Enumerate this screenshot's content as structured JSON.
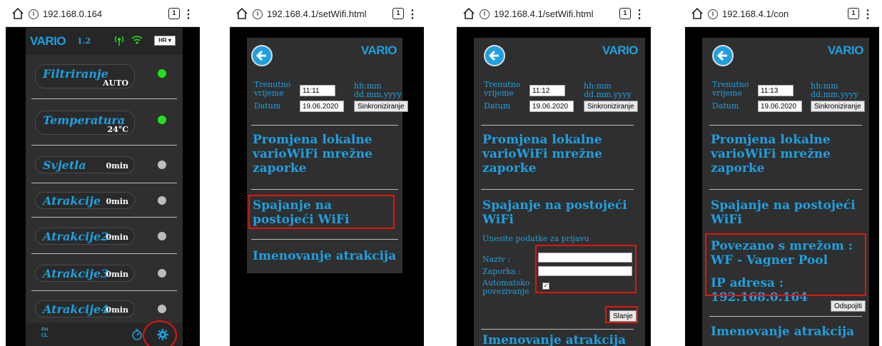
{
  "screens": [
    {
      "url": "192.168.0.164",
      "tab_count": "1",
      "header": {
        "logo": "VARIO",
        "version": "1.2",
        "lang": "HR ▾"
      },
      "items": [
        {
          "name": "Filtriranje",
          "sub": "AUTO",
          "dot": "#22e01e"
        },
        {
          "name": "Temperatura",
          "sub": "24°C",
          "dot": "#22e01e"
        },
        {
          "name": "Svjetla",
          "sub": "0min",
          "dot": "#bdbdbd"
        },
        {
          "name": "Atrakcije",
          "sub": "0min",
          "dot": "#bdbdbd"
        },
        {
          "name": "Atrakcije2",
          "sub": "0min",
          "dot": "#bdbdbd"
        },
        {
          "name": "Atrakcije3",
          "sub": "0min",
          "dot": "#bdbdbd"
        },
        {
          "name": "Atrakcije4",
          "sub": "0min",
          "dot": "#bdbdbd"
        }
      ],
      "footer": {
        "ph_cl": "PH\nCL"
      }
    },
    {
      "url": "192.168.4.1/setWifi.html",
      "tab_count": "1",
      "logo": "VARIO",
      "time_label": "Trenutno vrijeme",
      "time_value": "11:11",
      "time_hint": "hh:mm",
      "date_label": "Datum",
      "date_value": "19.06.2020",
      "date_hint": "dd.mm.yyyy",
      "sync_button": "Sinkroniziranje",
      "section1": "Promjena lokalne varioWiFi mrežne zaporke",
      "section2": "Spajanje na postojeći WiFi",
      "section3": "Imenovanje atrakcija"
    },
    {
      "url": "192.168.4.1/setWifi.html",
      "tab_count": "1",
      "logo": "VARIO",
      "time_label": "Trenutno vrijeme",
      "time_value": "11:12",
      "time_hint": "hh:mm",
      "date_label": "Datum",
      "date_value": "19.06.2020",
      "date_hint": "dd.mm.yyyy",
      "sync_button": "Sinkroniziranje",
      "section1": "Promjena lokalne varioWiFi mrežne zaporke",
      "section2": "Spajanje na postojeći WiFi",
      "login_prompt": "Unesite podatke za prijavu",
      "name_label": "Naziv :",
      "password_label": "Zaporka :",
      "auto_label": "Automatsko povezivanje",
      "send_button": "Slanje",
      "section3": "Imenovanje atrakcija"
    },
    {
      "url": "192.168.4.1/con",
      "tab_count": "1",
      "logo": "VARIO",
      "time_label": "Trenutno vrijeme",
      "time_value": "11:13",
      "time_hint": "hh:mm",
      "date_label": "Datum",
      "date_value": "19.06.2020",
      "date_hint": "dd.mm.yyyy",
      "sync_button": "Sinkroniziranje",
      "section1": "Promjena lokalne varioWiFi mrežne zaporke",
      "section2": "Spajanje na postojeći WiFi",
      "connected_line1": "Povezano s mrežom :",
      "connected_line2": "WF - Vagner Pool",
      "ip_line": "IP adresa : 192.168.0.164",
      "disconnect_button": "Odspojiti",
      "section3": "Imenovanje atrakcija"
    }
  ],
  "colors": {
    "accent": "#1ea0e0",
    "highlight": "#e3140e",
    "panel": "#2f2f2f"
  }
}
